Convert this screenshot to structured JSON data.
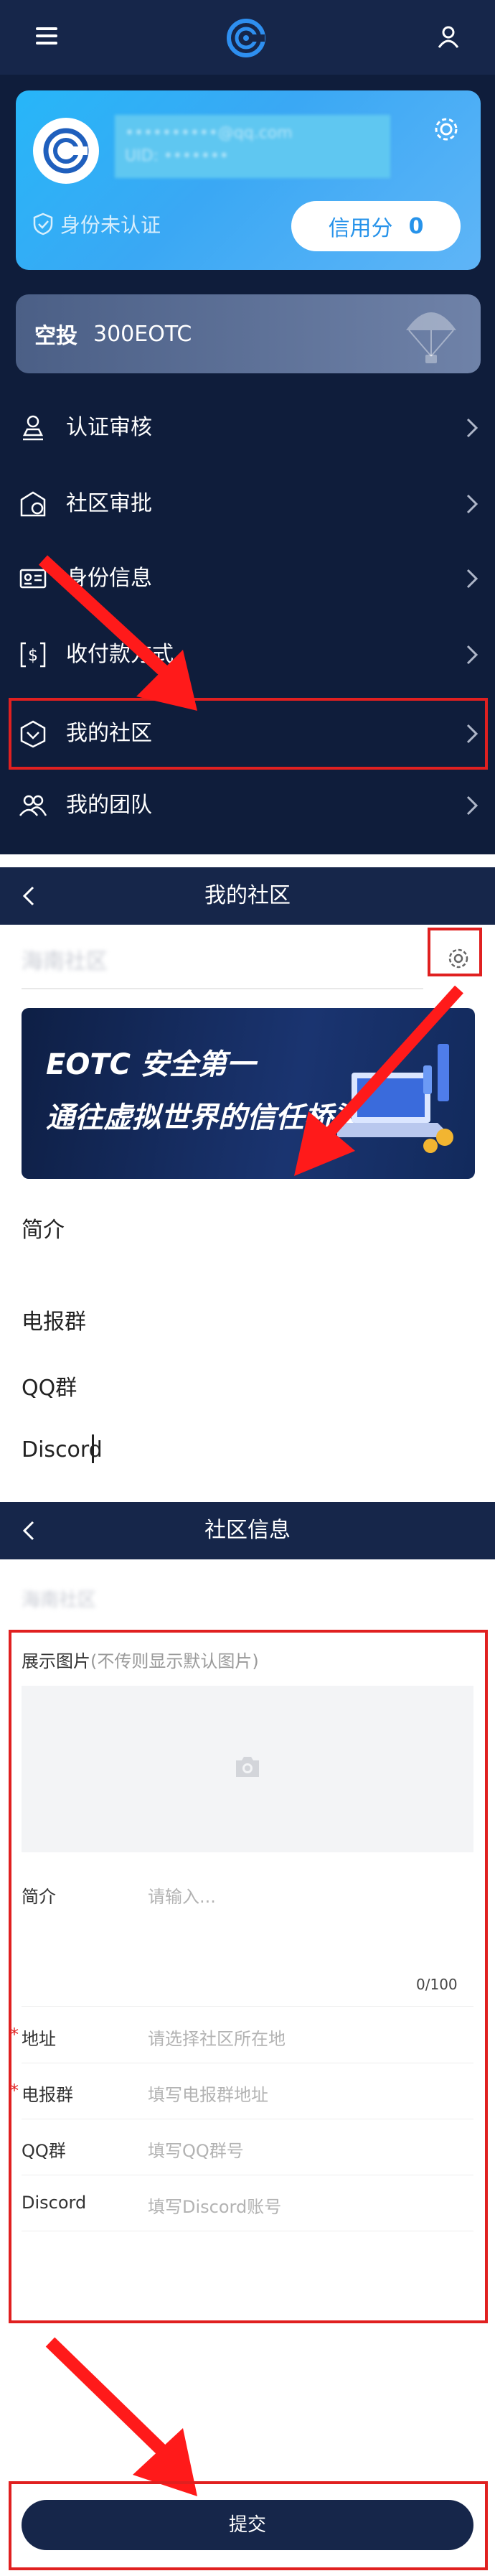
{
  "panel1": {
    "profile": {
      "email": "••••••••••@qq.com",
      "uid": "UID: •••••••",
      "verify_status": "身份未认证",
      "credit_label": "信用分",
      "credit_value": "0"
    },
    "airdrop": {
      "label": "空投",
      "amount": "300EOTC"
    },
    "menu": [
      {
        "label": "认证审核",
        "icon": "stamp-icon"
      },
      {
        "label": "社区审批",
        "icon": "community-approve-icon"
      },
      {
        "label": "身份信息",
        "icon": "id-card-icon"
      },
      {
        "label": "收付款方式",
        "icon": "payment-icon"
      },
      {
        "label": "我的社区",
        "icon": "community-icon"
      },
      {
        "label": "我的团队",
        "icon": "team-icon"
      }
    ]
  },
  "panel2": {
    "title": "我的社区",
    "community_name": "海南社区",
    "banner_line1": "EOTC 安全第一",
    "banner_line2": "通往虚拟世界的信任桥梁",
    "fields": [
      "简介",
      "电报群",
      "QQ群",
      "Discord"
    ]
  },
  "panel3": {
    "title": "社区信息",
    "community_name": "海南社区",
    "image_label": "展示图片",
    "image_hint": "(不传则显示默认图片)",
    "intro_label": "简介",
    "intro_placeholder": "请输入...",
    "intro_counter": "0/100",
    "rows": [
      {
        "label": "地址",
        "placeholder": "请选择社区所在地",
        "required": true
      },
      {
        "label": "电报群",
        "placeholder": "填写电报群地址",
        "required": true
      },
      {
        "label": "QQ群",
        "placeholder": "填写QQ群号",
        "required": false
      },
      {
        "label": "Discord",
        "placeholder": "填写Discord账号",
        "required": false
      }
    ],
    "submit_label": "提交"
  },
  "colors": {
    "nav": "#16264a",
    "bg_dark": "#0f1d3b",
    "highlight": "#e02020",
    "accent": "#2793ea"
  }
}
